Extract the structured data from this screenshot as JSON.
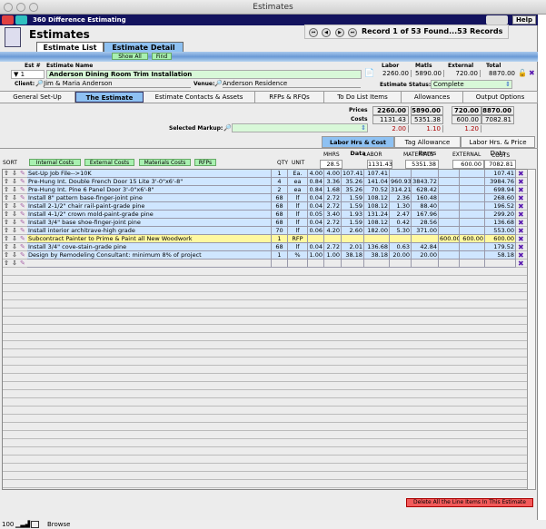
{
  "window": {
    "title": "Estimates"
  },
  "appbar": {
    "title": "360 Difference Estimating",
    "help": "Help"
  },
  "header": {
    "title": "Estimates",
    "record_text": "Record 1 of 53 Found...53 Records"
  },
  "view_tabs": [
    "Estimate List",
    "Estimate Detail"
  ],
  "band_buttons": {
    "show_all": "Show All",
    "find": "Find"
  },
  "estimate": {
    "est_label": "Est #",
    "est_num": "1",
    "name_label": "Estimate Name",
    "name": "Anderson Dining Room Trim Installation",
    "client_label": "Client:",
    "client": "Jim & Maria Anderson",
    "venue_label": "Venue:",
    "venue": "Anderson Residence",
    "labor_label": "Labor",
    "labor": "2260.00",
    "matls_label": "Matls",
    "matls": "5890.00",
    "external_label": "External",
    "external": "720.00",
    "total_label": "Total",
    "total": "8870.00",
    "status_label": "Estimate Status:",
    "status": "Complete"
  },
  "tabs": [
    "General Set-Up",
    "The Estimate",
    "Estimate Contacts & Assets",
    "RFPs & RFQs",
    "To Do List Items",
    "Allowances",
    "Output Options"
  ],
  "summary": {
    "prices_label": "Prices",
    "costs_label": "Costs",
    "markup_label": "Selected Markup:",
    "markup_value": "",
    "prices": [
      "2260.00",
      "5890.00",
      "720.00",
      "8870.00"
    ],
    "costs": [
      "1131.43",
      "5351.38",
      "600.00",
      "7082.81"
    ],
    "markups": [
      "2.00",
      "1.10",
      "1.20"
    ]
  },
  "subtabs": [
    "Labor Hrs & Cost Data",
    "Tag Allowance Items",
    "Labor Hrs. & Price Data"
  ],
  "columns": {
    "sort": "SORT",
    "filters": [
      "Internal Costs",
      "External Costs",
      "Materials Costs",
      "RFPs"
    ],
    "qty": "QTY",
    "unit": "UNIT",
    "mhrs": "MHRS",
    "labor": "LABOR",
    "materials": "MATERIALS",
    "external": "EXTERNAL",
    "costs": "COSTS",
    "totals": {
      "mhrs": "28.5",
      "labor": "1131.43",
      "materials": "5351.38",
      "external": "600.00",
      "costs": "7082.81"
    }
  },
  "rows": [
    {
      "desc": "Set-Up Job File-->10K",
      "qty": "1",
      "unit": "Ea.",
      "m1": "4.00",
      "m2": "4.00",
      "lr": "107.41",
      "lt": "107.41",
      "mu": "",
      "mt": "",
      "e1": "",
      "e2": "",
      "cost": "107.41",
      "hl": false
    },
    {
      "desc": "Pre-Hung Int. Double French Door 15 Lite 3'-0\"x6'-8\"",
      "qty": "4",
      "unit": "ea",
      "m1": "0.84",
      "m2": "3.36",
      "lr": "35.26",
      "lt": "141.04",
      "mu": "960.93",
      "mt": "3843.72",
      "e1": "",
      "e2": "",
      "cost": "3984.76",
      "hl": false
    },
    {
      "desc": "Pre-Hung Int. Pine 6 Panel Door 3'-0\"x6'-8\"",
      "qty": "2",
      "unit": "ea",
      "m1": "0.84",
      "m2": "1.68",
      "lr": "35.26",
      "lt": "70.52",
      "mu": "314.21",
      "mt": "628.42",
      "e1": "",
      "e2": "",
      "cost": "698.94",
      "hl": false
    },
    {
      "desc": "Install 8\" pattern base-finger-joint pine",
      "qty": "68",
      "unit": "lf",
      "m1": "0.04",
      "m2": "2.72",
      "lr": "1.59",
      "lt": "108.12",
      "mu": "2.36",
      "mt": "160.48",
      "e1": "",
      "e2": "",
      "cost": "268.60",
      "hl": false
    },
    {
      "desc": "Install 2-1/2\" chair rail-paint-grade pine",
      "qty": "68",
      "unit": "lf",
      "m1": "0.04",
      "m2": "2.72",
      "lr": "1.59",
      "lt": "108.12",
      "mu": "1.30",
      "mt": "88.40",
      "e1": "",
      "e2": "",
      "cost": "196.52",
      "hl": false
    },
    {
      "desc": "Install 4-1/2\" crown mold-paint-grade pine",
      "qty": "68",
      "unit": "lf",
      "m1": "0.05",
      "m2": "3.40",
      "lr": "1.93",
      "lt": "131.24",
      "mu": "2.47",
      "mt": "167.96",
      "e1": "",
      "e2": "",
      "cost": "299.20",
      "hl": false
    },
    {
      "desc": "Install 3/4\" base shoe-finger-joint pine",
      "qty": "68",
      "unit": "lf",
      "m1": "0.04",
      "m2": "2.72",
      "lr": "1.59",
      "lt": "108.12",
      "mu": "0.42",
      "mt": "28.56",
      "e1": "",
      "e2": "",
      "cost": "136.68",
      "hl": false
    },
    {
      "desc": "Install interior architrave-high grade",
      "qty": "70",
      "unit": "lf",
      "m1": "0.06",
      "m2": "4.20",
      "lr": "2.60",
      "lt": "182.00",
      "mu": "5.30",
      "mt": "371.00",
      "e1": "",
      "e2": "",
      "cost": "553.00",
      "hl": false
    },
    {
      "desc": "Subcontract Painter to Prime & Paint all New Woodwork",
      "qty": "1",
      "unit": "RFP",
      "m1": "",
      "m2": "",
      "lr": "",
      "lt": "",
      "mu": "",
      "mt": "",
      "e1": "600.00",
      "e2": "600.00",
      "cost": "600.00",
      "hl": true
    },
    {
      "desc": "Install 3/4\" cove-stain-grade pine",
      "qty": "68",
      "unit": "lf",
      "m1": "0.04",
      "m2": "2.72",
      "lr": "2.01",
      "lt": "136.68",
      "mu": "0.63",
      "mt": "42.84",
      "e1": "",
      "e2": "",
      "cost": "179.52",
      "hl": false
    },
    {
      "desc": "Design by Remodeling Consultant: minimum 8% of project",
      "qty": "1",
      "unit": "%",
      "m1": "1.00",
      "m2": "1.00",
      "lr": "38.18",
      "lt": "38.18",
      "mu": "20.00",
      "mt": "20.00",
      "e1": "",
      "e2": "",
      "cost": "58.18",
      "hl": false
    },
    {
      "desc": "",
      "qty": "",
      "unit": "",
      "m1": "",
      "m2": "",
      "lr": "",
      "lt": "",
      "mu": "",
      "mt": "",
      "e1": "",
      "e2": "",
      "cost": "",
      "hl": false,
      "empty": true
    }
  ],
  "footer": {
    "delete_all": "Delete All the Line Items In This Estimate"
  },
  "statusbar": {
    "zoom": "100",
    "mode": "Browse"
  }
}
